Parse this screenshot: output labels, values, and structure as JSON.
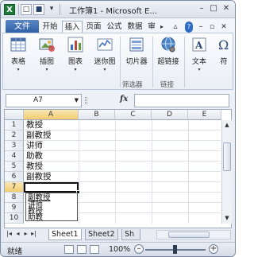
{
  "title": {
    "text": "工作簿1 - Microsoft E..."
  },
  "quick_access": {
    "undo_glyph": "↶",
    "redo_glyph": "↷",
    "save_glyph": "■",
    "more_glyph": "▾",
    "file_glyph": "□"
  },
  "window_controls": {
    "minimize": "–",
    "maximize": "□",
    "close": "✕"
  },
  "tabs": {
    "file": "文件",
    "items": [
      "开始",
      "插入",
      "页面",
      "公式",
      "数据",
      "审"
    ],
    "scroll": "▸"
  },
  "ribbon": {
    "buttons": [
      {
        "label": "表格",
        "icon": "table-icon"
      },
      {
        "label": "插图",
        "icon": "picture-icon"
      },
      {
        "label": "图表",
        "icon": "chart-icon"
      },
      {
        "label": "迷你图",
        "icon": "sparkline-icon"
      },
      {
        "label": "切片器",
        "icon": "slicer-icon"
      },
      {
        "label": "超链接",
        "icon": "hyperlink-icon"
      },
      {
        "label": "文本",
        "icon": "text-icon"
      },
      {
        "label": "符",
        "icon": "symbol-icon"
      }
    ],
    "groups": {
      "filter": "筛选器",
      "links": "链接"
    }
  },
  "formula_bar": {
    "name_box": "A7",
    "fx": "fx",
    "formula": ""
  },
  "grid": {
    "columns": [
      "A",
      "B",
      "C",
      "D",
      "E"
    ],
    "rows": [
      "1",
      "2",
      "3",
      "4",
      "5",
      "6",
      "7",
      "8",
      "9",
      "10"
    ],
    "cells": [
      "教授",
      "副教授",
      "讲师",
      "助教",
      "教授",
      "副教授"
    ],
    "pick_list": [
      "副教授",
      "讲师",
      "教授",
      "助教"
    ]
  },
  "sheet_tabs": {
    "nav": [
      "|◂",
      "◂",
      "▸",
      "▸|"
    ],
    "tabs": [
      "Sheet1",
      "Sheet2",
      "Sh"
    ]
  },
  "status_bar": {
    "mode": "就绪",
    "zoom": "100%",
    "minus": "–",
    "plus": "+"
  }
}
